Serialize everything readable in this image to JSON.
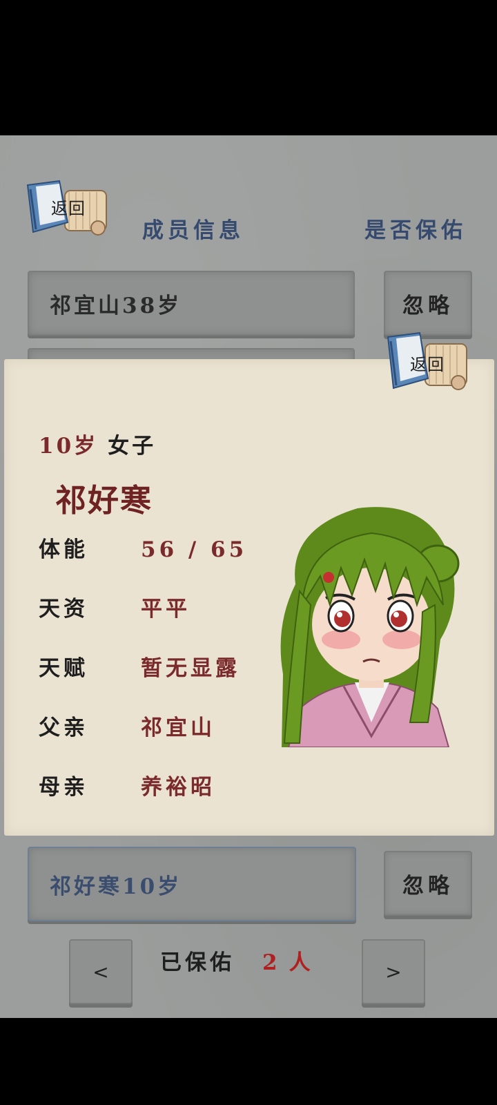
{
  "back_label": "返回",
  "header": {
    "member_info": "成员信息",
    "protect_question": "是否保佑"
  },
  "members": [
    {
      "label": "祁宜山38岁",
      "ignore_label": "忽略"
    },
    {
      "label": "祁好寒10岁",
      "ignore_label": "忽略"
    }
  ],
  "popup": {
    "back_label": "返回",
    "age": "10岁",
    "gender": "女子",
    "name": "祁好寒",
    "stats": [
      {
        "key": "体能",
        "value": "56 / 65"
      },
      {
        "key": "天资",
        "value": "平平"
      },
      {
        "key": "天赋",
        "value": "暂无显露"
      },
      {
        "key": "父亲",
        "value": "祁宜山"
      },
      {
        "key": "母亲",
        "value": "养裕昭"
      }
    ]
  },
  "footer": {
    "prev": "<",
    "next": ">",
    "saved_label": "已保佑",
    "saved_count": "2",
    "saved_unit": "人"
  },
  "colors": {
    "background": "#9b9e9c",
    "header_text": "#354a6e",
    "paper": "#ebe3d2",
    "value_red": "#7a2a2a"
  },
  "icons": {
    "back": "book-scroll-icon",
    "portrait": "girl-portrait"
  }
}
